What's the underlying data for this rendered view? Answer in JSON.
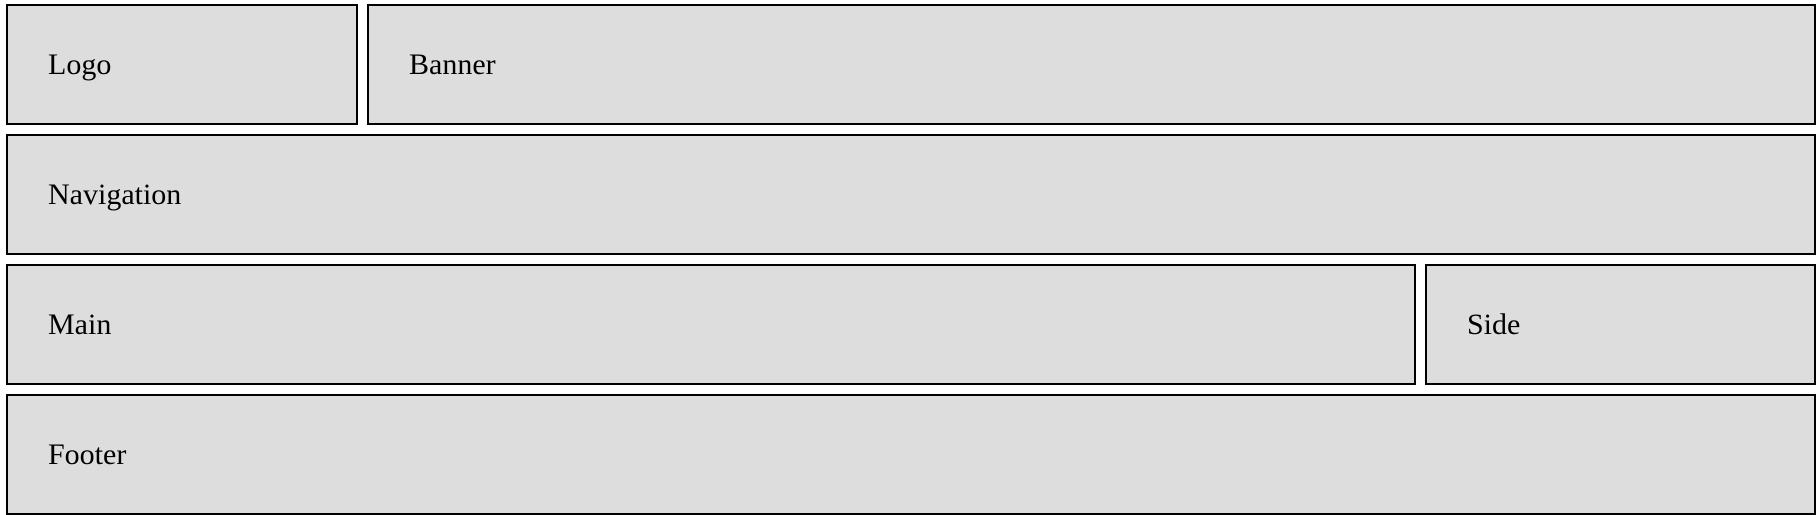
{
  "regions": {
    "logo": "Logo",
    "banner": "Banner",
    "navigation": "Navigation",
    "main": "Main",
    "side": "Side",
    "footer": "Footer"
  },
  "colors": {
    "box_fill": "#dddddd",
    "box_border": "#000000",
    "background": "#ffffff"
  }
}
